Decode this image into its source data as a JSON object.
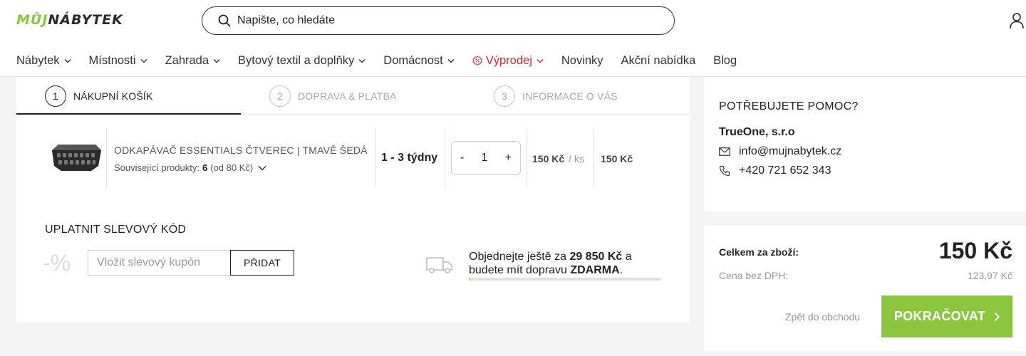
{
  "header": {
    "logo": {
      "part1": "MŮJ",
      "part2": "NÁBYTEK"
    },
    "search_placeholder": "Napište, co hledáte"
  },
  "nav": [
    {
      "label": "Nábytek",
      "dropdown": true
    },
    {
      "label": "Místnosti",
      "dropdown": true
    },
    {
      "label": "Zahrada",
      "dropdown": true
    },
    {
      "label": "Bytový textil a doplňky",
      "dropdown": true
    },
    {
      "label": "Domácnost",
      "dropdown": true
    },
    {
      "label": "Výprodej",
      "dropdown": true,
      "sale": true
    },
    {
      "label": "Novinky",
      "dropdown": false
    },
    {
      "label": "Akční nabídka",
      "dropdown": false
    },
    {
      "label": "Blog",
      "dropdown": false
    }
  ],
  "steps": [
    {
      "num": "1",
      "label": "NÁKUPNÍ KOŠÍK",
      "active": true
    },
    {
      "num": "2",
      "label": "DOPRAVA & PLATBA",
      "active": false
    },
    {
      "num": "3",
      "label": "INFORMACE O VÁS",
      "active": false
    }
  ],
  "cart_item": {
    "name": "ODKAPÁVAČ ESSENTIALS ČTVEREC | TMAVĚ ŠEDÁ",
    "related_label": "Související produkty:",
    "related_count": "6",
    "related_from": "(od 80 Kč)",
    "delivery": "1 - 3 týdny",
    "qty_minus": "-",
    "qty": "1",
    "qty_plus": "+",
    "unit_price": "150 Kč",
    "unit_suffix": "/ ks",
    "total_price": "150 Kč"
  },
  "discount": {
    "title": "UPLATNIT SLEVOVÝ KÓD",
    "symbol": "-%",
    "placeholder": "Vložit slevový kupón",
    "button": "PŘIDAT"
  },
  "shipping": {
    "text1": "Objednejte ještě za",
    "amount": "29 850 Kč",
    "text2": "a",
    "text3": "budete mít dopravu",
    "free": "ZDARMA",
    "end": ".",
    "progress": 0.005
  },
  "help": {
    "title": "POTŘEBUJETE POMOC?",
    "company": "TrueOne, s.r.o",
    "email": "info@mujnabytek.cz",
    "phone": "+420 721 652 343"
  },
  "summary": {
    "total_label": "Celkem za zboží:",
    "total_value": "150 Kč",
    "vat_label": "Cena bez DPH:",
    "vat_value": "123,97 Kč",
    "back_label": "Zpět do obchodu",
    "continue_label": "POKRAČOVAT"
  },
  "colors": {
    "accent": "#8cc63f",
    "sale": "#d12a33"
  }
}
